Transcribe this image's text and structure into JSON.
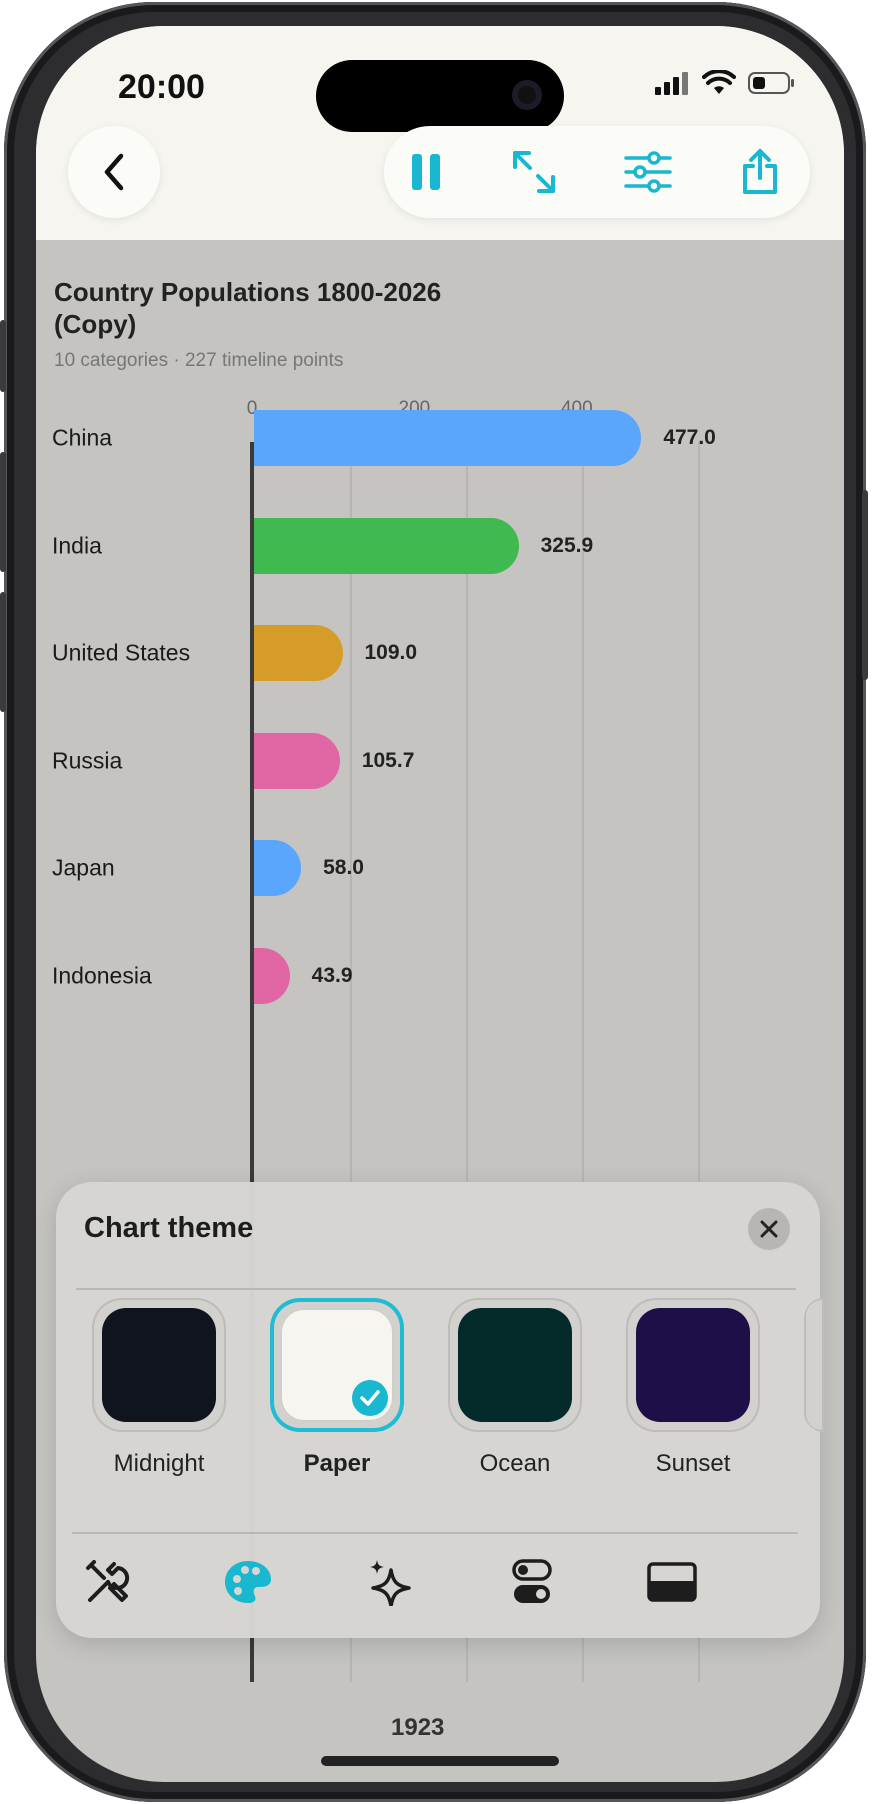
{
  "status_bar": {
    "time": "20:00"
  },
  "chart_data": {
    "type": "bar",
    "title": "Country Populations 1800-2026 (Copy)",
    "subtitle": "10 categories · 227 timeline points",
    "x_ticks": [
      "0",
      "200",
      "400"
    ],
    "categories": [
      "China",
      "India",
      "United States",
      "Russia",
      "Japan",
      "Indonesia"
    ],
    "values": [
      477.0,
      325.9,
      109.0,
      105.7,
      58.0,
      43.9
    ],
    "value_labels": [
      "477.0",
      "325.9",
      "109.0",
      "105.7",
      "58.0",
      "43.9"
    ],
    "colors": [
      "#5aa6fc",
      "#3fb950",
      "#d69c28",
      "#e066a4",
      "#5aa6fc",
      "#e066a4"
    ],
    "grid": true,
    "year": "1923"
  },
  "theme_sheet": {
    "title": "Chart theme",
    "themes": [
      {
        "label": "Midnight",
        "color": "#0f141d",
        "selected": false
      },
      {
        "label": "Paper",
        "color": "#f6f5f0",
        "selected": true
      },
      {
        "label": "Ocean",
        "color": "#052a2a",
        "selected": false
      },
      {
        "label": "Sunset",
        "color": "#1e0f48",
        "selected": false
      }
    ],
    "tabs": [
      "tools-icon",
      "palette-icon",
      "sparkles-icon",
      "toggles-icon",
      "layout-icon"
    ]
  },
  "accent_color": "#19b7d0"
}
